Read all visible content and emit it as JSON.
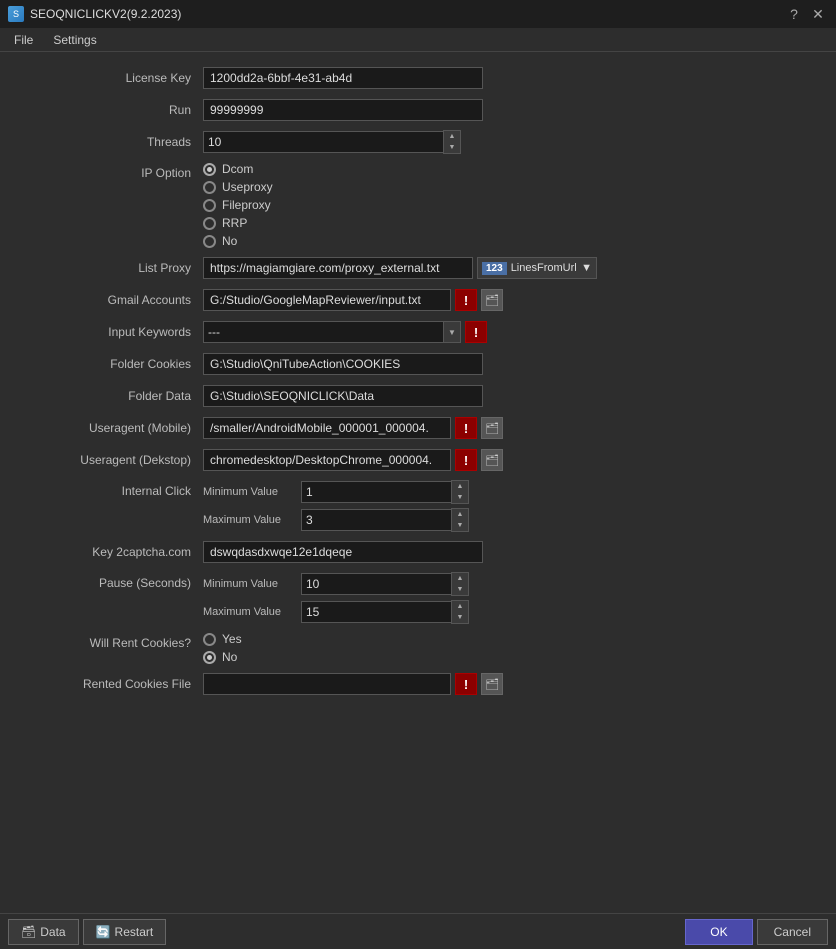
{
  "title": "SEOQNICLICKV2(9.2.2023)",
  "menu": {
    "file": "File",
    "settings": "Settings"
  },
  "fields": {
    "license_key": {
      "label": "License Key",
      "value": "1200dd2a-6bbf-4e31-ab4d"
    },
    "run": {
      "label": "Run",
      "value": "99999999"
    },
    "threads": {
      "label": "Threads",
      "value": "10"
    },
    "ip_option": {
      "label": "IP Option",
      "options": [
        {
          "id": "dcom",
          "label": "Dcom",
          "selected": true
        },
        {
          "id": "useproxy",
          "label": "Useproxy",
          "selected": false
        },
        {
          "id": "fileproxy",
          "label": "Fileproxy",
          "selected": false
        },
        {
          "id": "rrp",
          "label": "RRP",
          "selected": false
        },
        {
          "id": "no",
          "label": "No",
          "selected": false
        }
      ]
    },
    "list_proxy": {
      "label": "List Proxy",
      "value": "https://magiamgiare.com/proxy_external.txt",
      "dropdown_badge": "123",
      "dropdown_label": "LinesFromUrl",
      "dropdown_arrow": "▼"
    },
    "gmail_accounts": {
      "label": "Gmail Accounts",
      "value": "G:/Studio/GoogleMapReviewer/input.txt"
    },
    "input_keywords": {
      "label": "Input Keywords",
      "value": "---"
    },
    "folder_cookies": {
      "label": "Folder Cookies",
      "value": "G:\\Studio\\QniTubeAction\\COOKIES"
    },
    "folder_data": {
      "label": "Folder Data",
      "value": "G:\\Studio\\SEOQNICLICK\\Data"
    },
    "useragent_mobile": {
      "label": "Useragent (Mobile)",
      "value": "/smaller/AndroidMobile_000001_000004."
    },
    "useragent_desktop": {
      "label": "Useragent (Dekstop)",
      "value": "chromedesktop/DesktopChrome_000004."
    },
    "internal_click": {
      "label": "Internal Click",
      "min_label": "Minimum Value",
      "min_value": "1",
      "max_label": "Maximum Value",
      "max_value": "3"
    },
    "key_2captcha": {
      "label": "Key 2captcha.com",
      "value": "dswqdasdxwqe12e1dqeqe"
    },
    "pause_seconds": {
      "label": "Pause (Seconds)",
      "min_label": "Minimum Value",
      "min_value": "10",
      "max_label": "Maximum Value",
      "max_value": "15"
    },
    "will_rent_cookies": {
      "label": "Will Rent Cookies?",
      "options": [
        {
          "id": "yes",
          "label": "Yes",
          "selected": false
        },
        {
          "id": "no",
          "label": "No",
          "selected": true
        }
      ]
    },
    "rented_cookies_file": {
      "label": "Rented Cookies File",
      "value": ""
    }
  },
  "footer": {
    "data_btn": "Data",
    "restart_btn": "Restart",
    "ok_btn": "OK",
    "cancel_btn": "Cancel"
  },
  "icons": {
    "exclamation": "!",
    "folder": "🗂",
    "up_arrow": "▲",
    "down_arrow": "▼",
    "database": "🗃",
    "restart": "🔄"
  }
}
